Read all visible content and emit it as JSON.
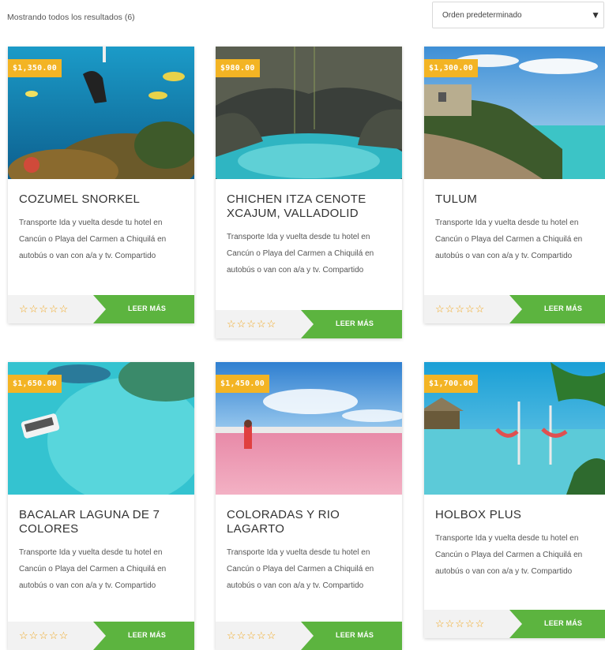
{
  "results_text": "Mostrando todos los resultados (6)",
  "sort": {
    "selected": "Orden predeterminado"
  },
  "colors": {
    "price_badge": "#f3b424",
    "button": "#5cb43f",
    "stars": "#f0a51c"
  },
  "rating_stars": "☆☆☆☆☆",
  "tours": [
    {
      "price": "$1,350.00",
      "title": "COZUMEL SNORKEL",
      "description": "Transporte Ida y vuelta desde tu hotel en Cancún o Playa del Carmen a Chiquilá en autobús o van con a/a y tv. Compartido",
      "button": "LEER MÁS"
    },
    {
      "price": "$980.00",
      "title": "CHICHEN ITZA CENOTE XCAJUM, VALLADOLID",
      "description": "Transporte Ida y vuelta desde tu hotel en Cancún o Playa del Carmen a Chiquilá en autobús o van con a/a y tv. Compartido",
      "button": "LEER MÁS"
    },
    {
      "price": "$1,300.00",
      "title": "TULUM",
      "description": "Transporte Ida y vuelta desde tu hotel en Cancún o Playa del Carmen a Chiquilá en autobús o van con a/a y tv. Compartido",
      "button": "LEER MÁS"
    },
    {
      "price": "$1,650.00",
      "title": "BACALAR LAGUNA DE 7 COLORES",
      "description": "Transporte Ida y vuelta desde tu hotel en Cancún o Playa del Carmen a Chiquilá en autobús o van con a/a y tv. Compartido",
      "button": "LEER MÁS"
    },
    {
      "price": "$1,450.00",
      "title": "COLORADAS Y RIO LAGARTO",
      "description": "Transporte Ida y vuelta desde tu hotel en Cancún o Playa del Carmen a Chiquilá en autobús o van con a/a y tv. Compartido",
      "button": "LEER MÁS"
    },
    {
      "price": "$1,700.00",
      "title": "HOLBOX PLUS",
      "description": "Transporte Ida y vuelta desde tu hotel en Cancún o Playa del Carmen a Chiquilá en autobús o van con a/a y tv. Compartido",
      "button": "LEER MÁS"
    }
  ]
}
